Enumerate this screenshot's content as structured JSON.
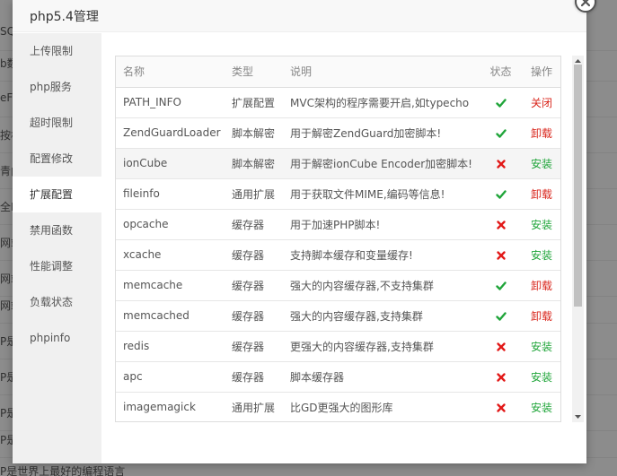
{
  "background": {
    "rows": [
      "SQ",
      "b数",
      "eF",
      "按机",
      "青内",
      "全P",
      "网站",
      "网站",
      "网站",
      "P是",
      "P是",
      "P是",
      "P是"
    ],
    "bottom_text": "P是世界上最好的编程语言"
  },
  "modal": {
    "title": "php5.4管理"
  },
  "sidebar": {
    "items": [
      {
        "label": "上传限制"
      },
      {
        "label": "php服务"
      },
      {
        "label": "超时限制"
      },
      {
        "label": "配置修改"
      },
      {
        "label": "扩展配置"
      },
      {
        "label": "禁用函数"
      },
      {
        "label": "性能调整"
      },
      {
        "label": "负载状态"
      },
      {
        "label": "phpinfo"
      }
    ]
  },
  "table": {
    "headers": {
      "name": "名称",
      "type": "类型",
      "desc": "说明",
      "status": "状态",
      "op": "操作"
    },
    "rows": [
      {
        "name": "PATH_INFO",
        "type": "扩展配置",
        "desc": "MVC架构的程序需要开启,如typecho",
        "status": "enabled",
        "op": "关闭"
      },
      {
        "name": "ZendGuardLoader",
        "type": "脚本解密",
        "desc": "用于解密ZendGuard加密脚本!",
        "status": "enabled",
        "op": "卸载"
      },
      {
        "name": "ionCube",
        "type": "脚本解密",
        "desc": "用于解密ionCube Encoder加密脚本!",
        "status": "disabled",
        "op": "安装"
      },
      {
        "name": "fileinfo",
        "type": "通用扩展",
        "desc": "用于获取文件MIME,编码等信息!",
        "status": "enabled",
        "op": "卸载"
      },
      {
        "name": "opcache",
        "type": "缓存器",
        "desc": "用于加速PHP脚本!",
        "status": "disabled",
        "op": "安装"
      },
      {
        "name": "xcache",
        "type": "缓存器",
        "desc": "支持脚本缓存和变量缓存!",
        "status": "disabled",
        "op": "安装"
      },
      {
        "name": "memcache",
        "type": "缓存器",
        "desc": "强大的内容缓存器,不支持集群",
        "status": "enabled",
        "op": "卸载"
      },
      {
        "name": "memcached",
        "type": "缓存器",
        "desc": "强大的内容缓存器,支持集群",
        "status": "enabled",
        "op": "卸载"
      },
      {
        "name": "redis",
        "type": "缓存器",
        "desc": "更强大的内容缓存器,支持集群",
        "status": "disabled",
        "op": "安装"
      },
      {
        "name": "apc",
        "type": "缓存器",
        "desc": "脚本缓存器",
        "status": "disabled",
        "op": "安装"
      },
      {
        "name": "imagemagick",
        "type": "通用扩展",
        "desc": "比GD更强大的图形库",
        "status": "disabled",
        "op": "安装"
      }
    ]
  },
  "colors": {
    "enabled": "#20a53a",
    "disabled": "#e21918",
    "op_uninstall": "#d9261c",
    "op_install": "#20a53a"
  },
  "icons": {
    "close": "close-icon",
    "enabled": "check-icon",
    "disabled": "cross-icon"
  }
}
